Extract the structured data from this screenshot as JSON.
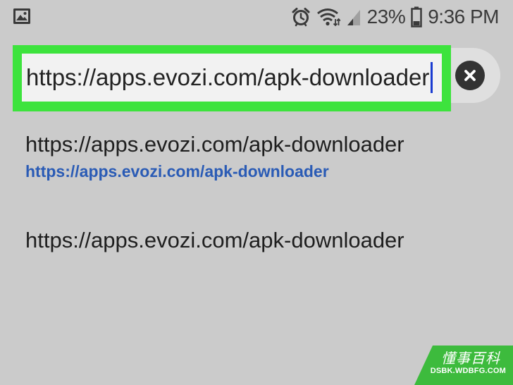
{
  "status_bar": {
    "battery": "23%",
    "time": "9:36 PM",
    "icons": [
      "gallery-icon",
      "alarm-icon",
      "wifi-icon",
      "signal-icon",
      "battery-icon"
    ]
  },
  "address_bar": {
    "value": "https://apps.evozi.com/apk-downloader",
    "highlight_color": "#3de33d",
    "clear_icon": "close-icon"
  },
  "suggestions": [
    {
      "title": "https://apps.evozi.com/apk-downloader",
      "url": "https://apps.evozi.com/apk-downloader"
    },
    {
      "title": "https://apps.evozi.com/apk-downloader"
    }
  ],
  "colors": {
    "background": "#cbcbcb",
    "link": "#2a5bb5",
    "caret": "#1a3cd1",
    "watermark": "#3dbb3d"
  },
  "watermark": {
    "title": "懂事百科",
    "subtitle": "DSBK.WDBFG.COM"
  }
}
